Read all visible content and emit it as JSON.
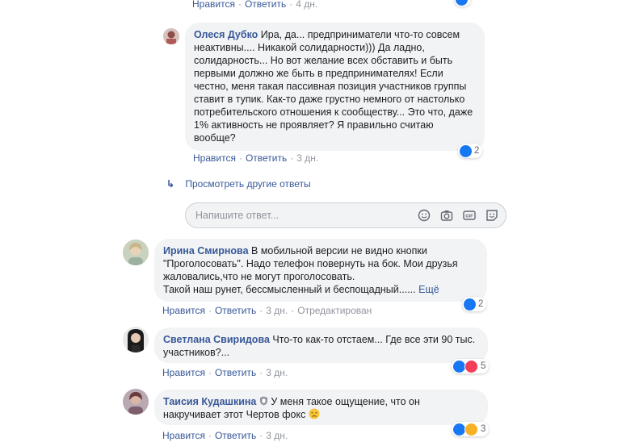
{
  "top_meta": {
    "like": "Нравится",
    "reply": "Ответить",
    "time": "4 дн."
  },
  "comments": [
    {
      "author": "Олеся Дубко",
      "text": "Ира, да... предприниматели что-то совсем неактивны.... Никакой солидарности))) Да ладно, солидарность... Но вот желание всех обставить и быть первыми должно же быть в предпринимателях! Если честно, меня такая пассивная позиция участников группы ставит в тупик. Как-то даже грустно немного от настолько потребительского отношения к сообществу... Это что, даже 1% активность не проявляет? Я правильно считаю вообще?",
      "like": "Нравится",
      "reply": "Ответить",
      "time": "3 дн.",
      "reactions": "2"
    },
    {
      "author": "Ирина Смирнова",
      "text": "В мобильной версии не видно кнопки \"Проголосовать\". Надо телефон повернуть на бок. Мои друзья жаловались,что не могут проголосовать.",
      "text2": "Такой наш рунет, бессмысленный и беспощадный......",
      "more": "Ещё",
      "like": "Нравится",
      "reply": "Ответить",
      "time": "3 дн.",
      "edited": "Отредактирован",
      "reactions": "2"
    },
    {
      "author": "Светлана Свиридова",
      "text": "Что-то как-то отстаем... Где все эти 90 тыс. участников?...",
      "like": "Нравится",
      "reply": "Ответить",
      "time": "3 дн.",
      "reactions": "5"
    },
    {
      "author": "Таисия Кудашкина",
      "text": "У меня такое ощущение, что он накручивает этот Чертов фокс",
      "like": "Нравится",
      "reply": "Ответить",
      "time": "3 дн.",
      "reactions": "3"
    }
  ],
  "view_more_replies": "Просмотреть другие ответы",
  "reply_placeholder": "Напишите ответ...",
  "colors": {
    "link": "#385898",
    "bubble": "#f2f3f5",
    "like": "#1877f2",
    "heart": "#f33e58",
    "sad": "#f7b125"
  }
}
